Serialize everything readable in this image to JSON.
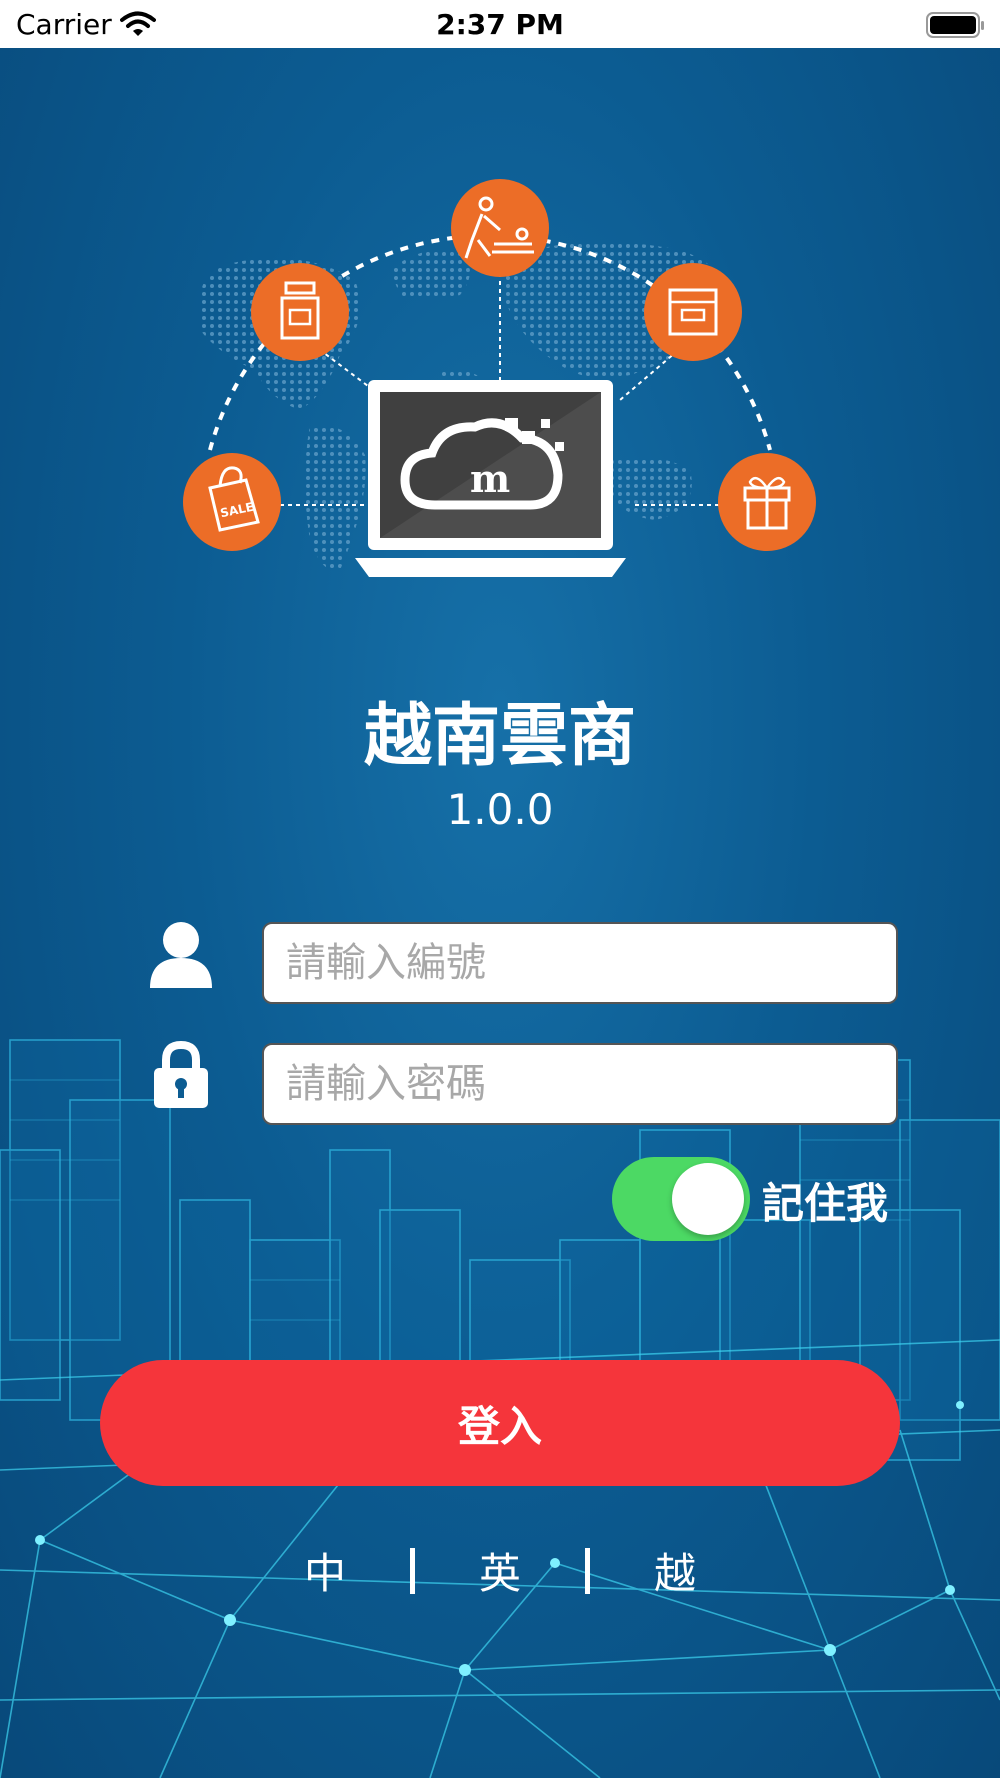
{
  "status_bar": {
    "carrier": "Carrier",
    "time": "2:37 PM",
    "icons": [
      "wifi-icon",
      "battery-icon"
    ]
  },
  "hero": {
    "icons": [
      "bottle-icon",
      "massage-icon",
      "package-box-icon",
      "sale-bag-icon",
      "gift-box-icon",
      "laptop-cloud-logo"
    ],
    "accent_color": "#ec6d27"
  },
  "app": {
    "title": "越南雲商",
    "version": "1.0.0"
  },
  "login_form": {
    "id_placeholder": "請輸入編號",
    "id_value": "",
    "password_placeholder": "請輸入密碼",
    "password_value": "",
    "remember_label": "記住我",
    "remember_on": true,
    "toggle_color": "#4cd964",
    "submit_label": "登入",
    "submit_color": "#f5353b"
  },
  "languages": [
    "中",
    "英",
    "越"
  ],
  "colors": {
    "background_primary": "#0c5c92",
    "background_dark": "#08497a"
  }
}
